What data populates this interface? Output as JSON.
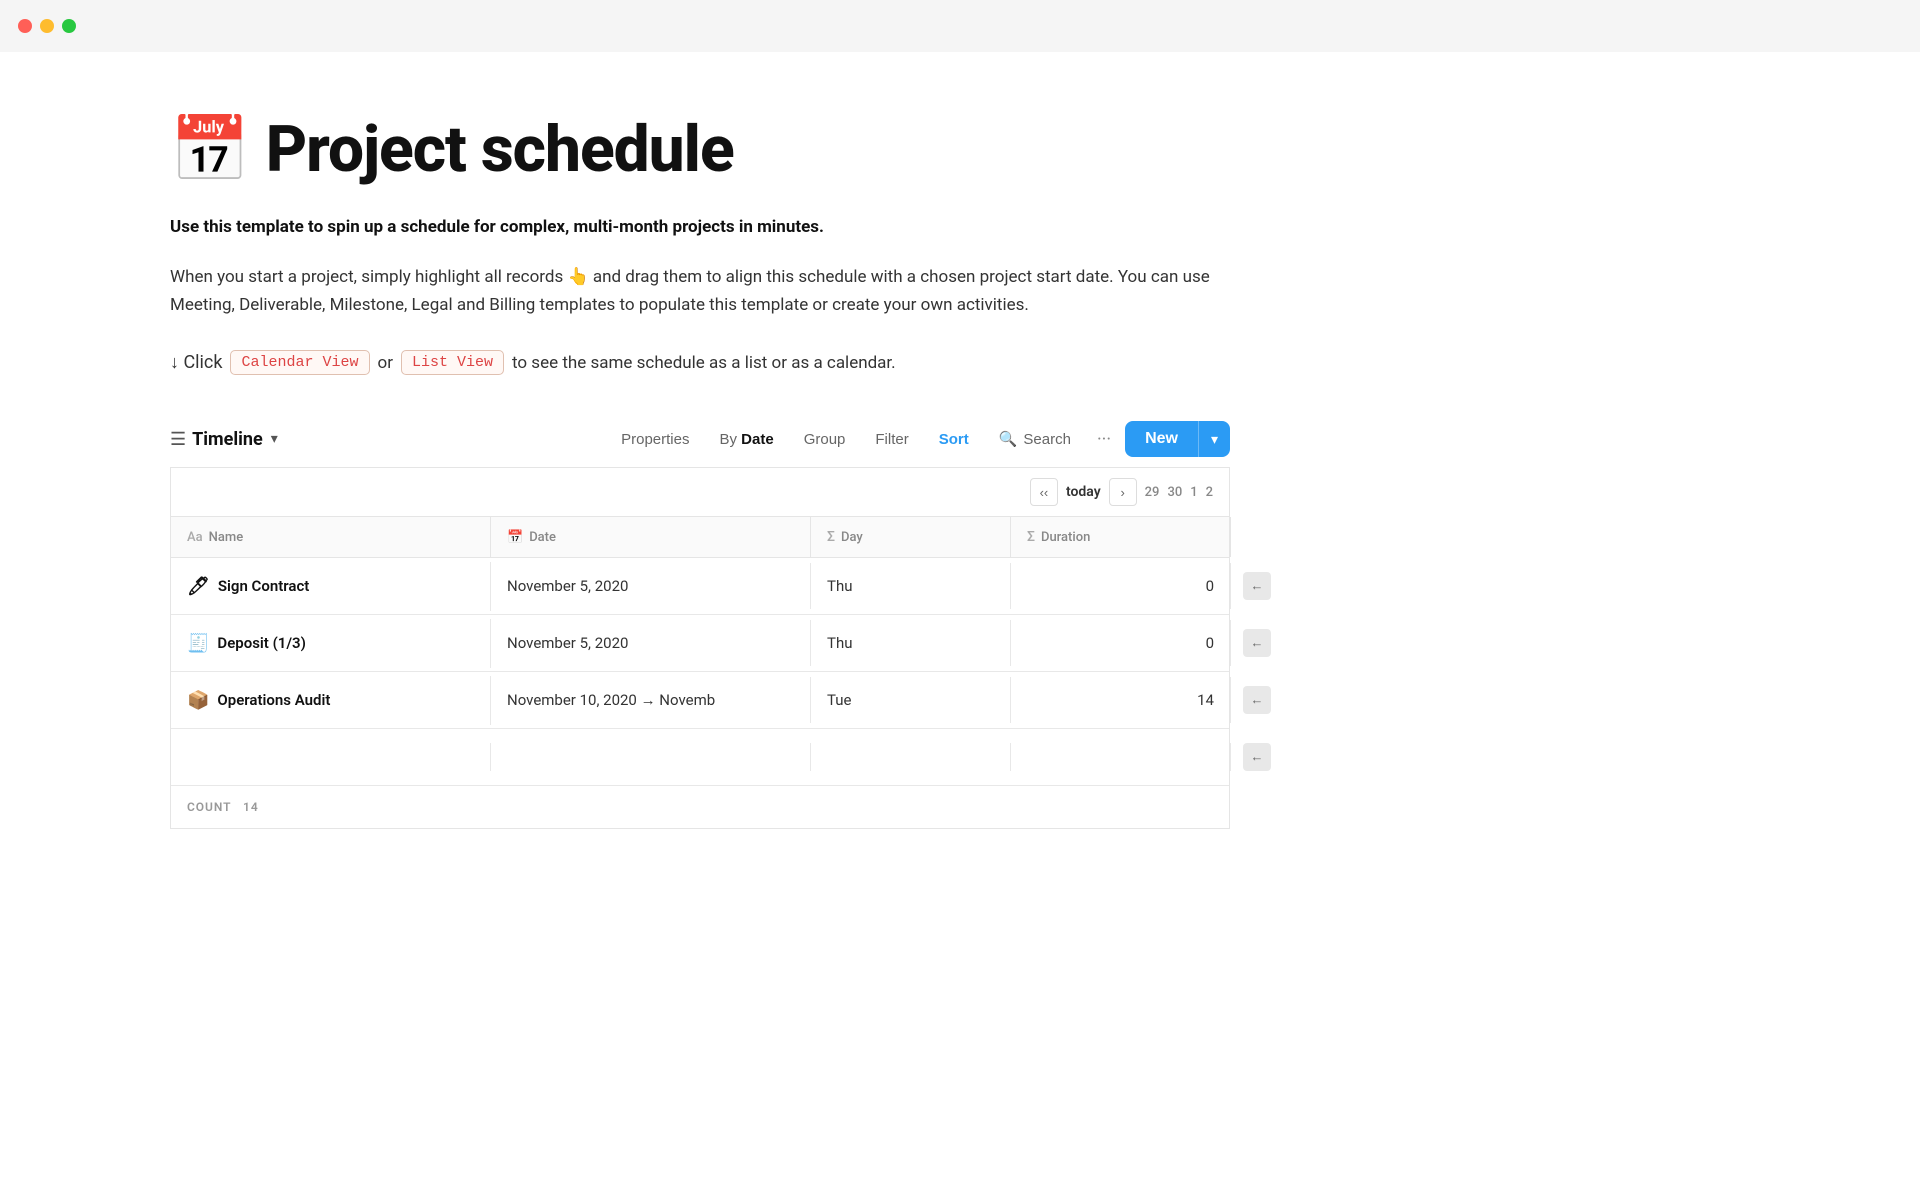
{
  "titlebar": {
    "traffic_lights": [
      "red",
      "yellow",
      "green"
    ]
  },
  "page": {
    "icon": "📅",
    "title": "Project schedule",
    "description_bold": "Use this template to spin up a schedule for complex, multi-month projects in minutes.",
    "description_body": "When you start a project, simply highlight all records 👆 and drag them to align this schedule with a chosen project start date. You can use Meeting, Deliverable, Milestone, Legal and Billing templates to populate this template or create your own activities.",
    "instruction_prefix": "↓ Click",
    "instruction_link1": "Calendar View",
    "instruction_middle": " or ",
    "instruction_link2": "List View",
    "instruction_suffix": " to see the same schedule as a list or as a calendar."
  },
  "toolbar": {
    "view_icon": "☰",
    "view_label": "Timeline",
    "properties_label": "Properties",
    "by_label": "By",
    "date_label": "Date",
    "group_label": "Group",
    "filter_label": "Filter",
    "sort_label": "Sort",
    "search_icon": "🔍",
    "search_label": "Search",
    "dots_label": "···",
    "new_label": "New",
    "new_chevron": "▾"
  },
  "timeline": {
    "nav_prev": "‹‹",
    "nav_today": "today",
    "nav_next": "›",
    "date_numbers": [
      "29",
      "30",
      "1",
      "2"
    ]
  },
  "table": {
    "columns": [
      {
        "icon": "Aa",
        "label": "Name"
      },
      {
        "icon": "📅",
        "label": "Date"
      },
      {
        "icon": "Σ",
        "label": "Day"
      },
      {
        "icon": "Σ",
        "label": "Duration"
      }
    ],
    "rows": [
      {
        "icon": "🖊",
        "name": "Sign Contract",
        "date": "November 5, 2020",
        "day": "Thu",
        "duration": "0"
      },
      {
        "icon": "🧾",
        "name": "Deposit (1/3)",
        "date": "November 5, 2020",
        "day": "Thu",
        "duration": "0"
      },
      {
        "icon": "📦",
        "name": "Operations Audit",
        "date": "November 10, 2020 → Novemb",
        "day": "Tue",
        "duration": "14"
      }
    ],
    "count_label": "COUNT",
    "count_value": "14"
  }
}
